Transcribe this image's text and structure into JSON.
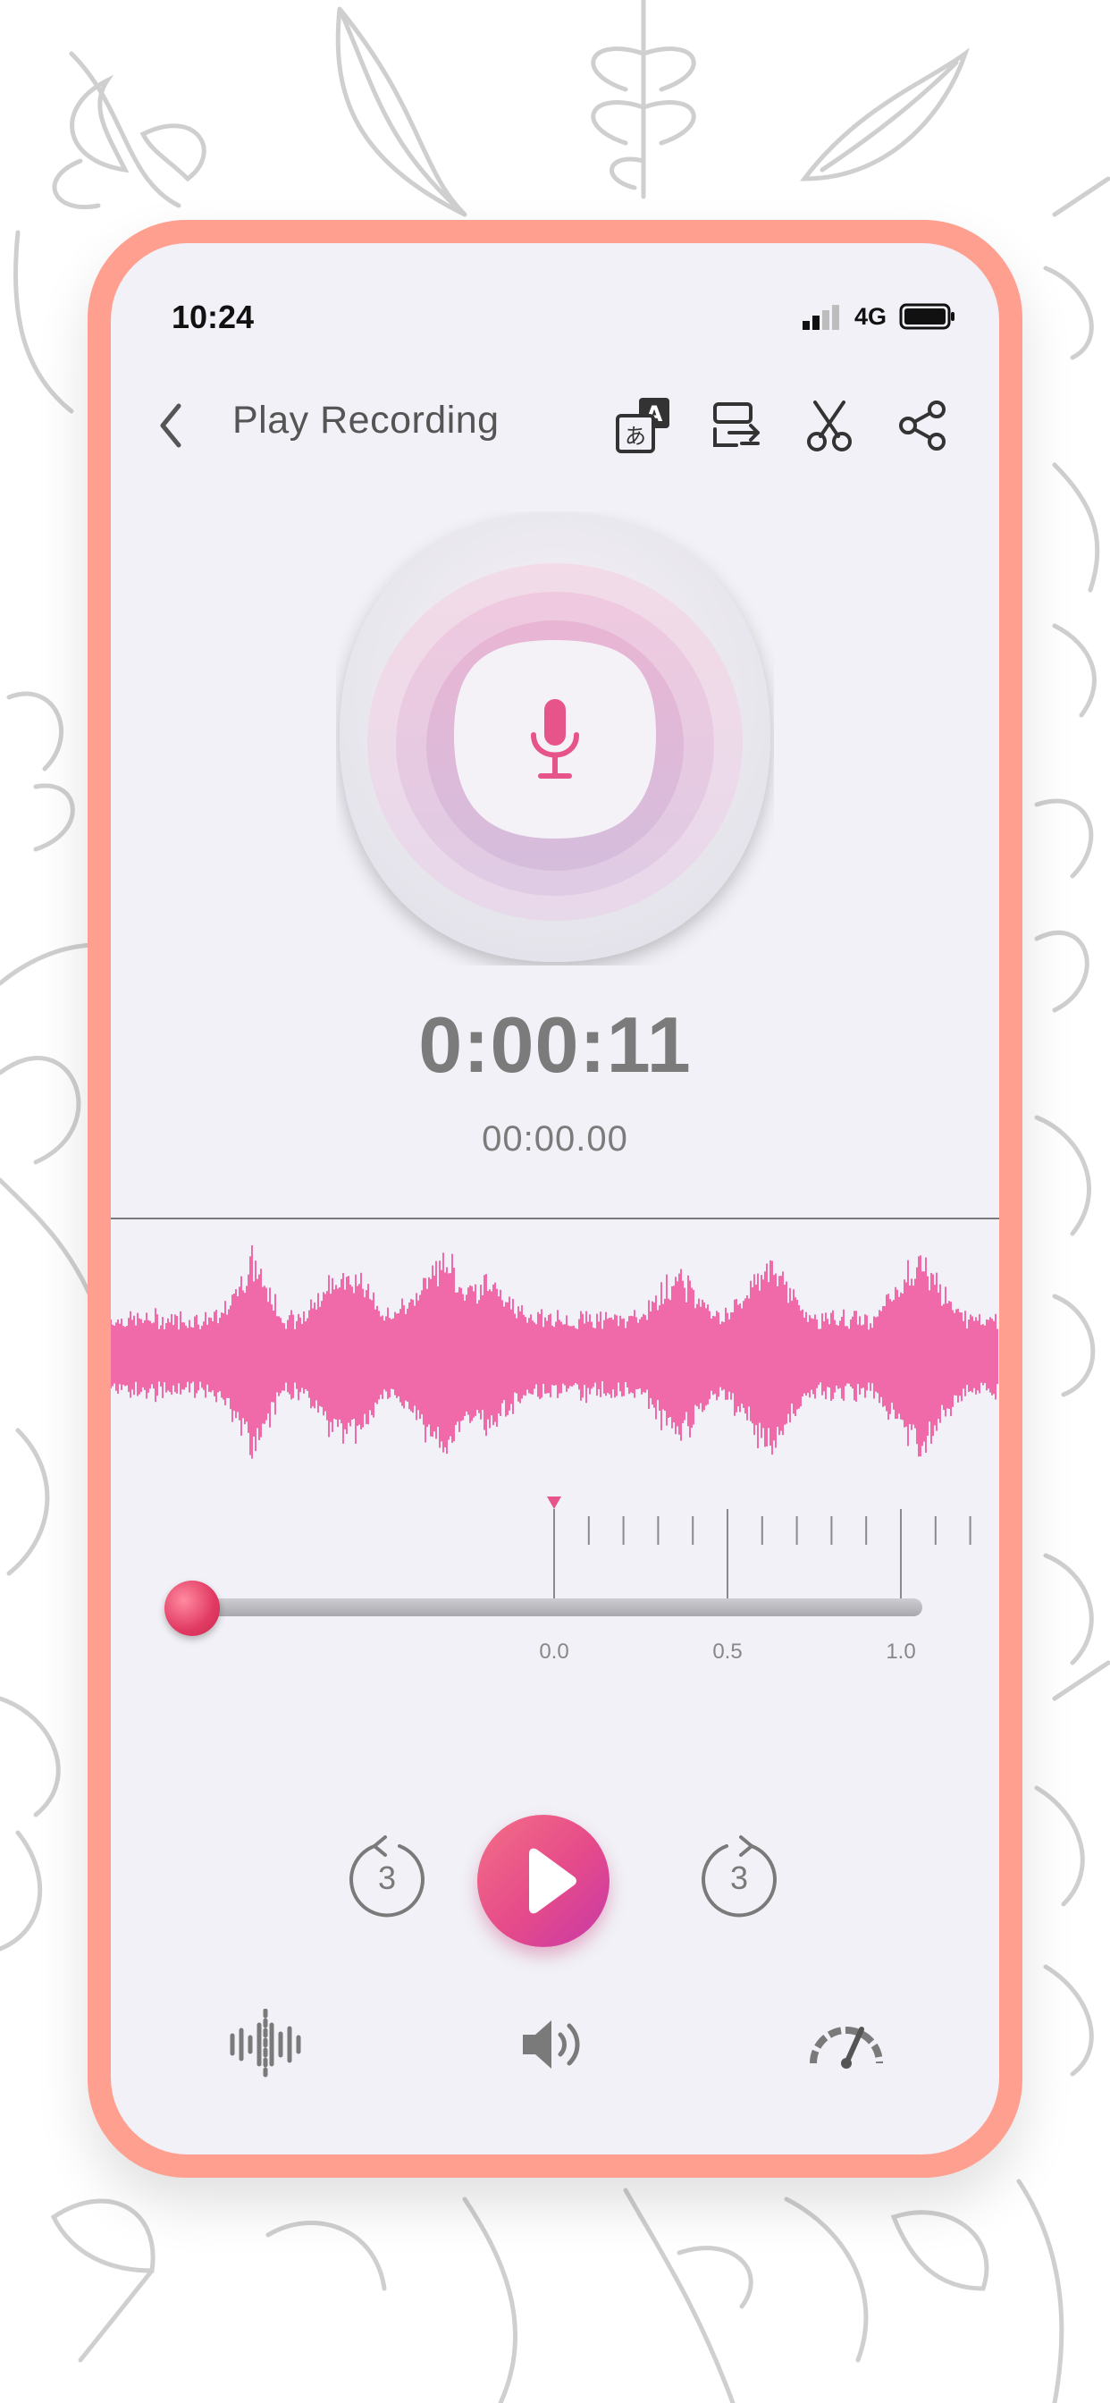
{
  "status_bar": {
    "time": "10:24",
    "network": "4G"
  },
  "header": {
    "back_icon": "chevron-left-icon",
    "title": "Play Recording",
    "actions": [
      "translate-icon",
      "convert-icon",
      "scissors-icon",
      "share-icon"
    ]
  },
  "recording": {
    "elapsed": "0:00:11",
    "position": "00:00.00",
    "mic_icon": "microphone-icon"
  },
  "timeline": {
    "labels": [
      "0.0",
      "0.5",
      "1.0"
    ]
  },
  "seek": {
    "progress": 0.0
  },
  "controls": {
    "rewind_seconds": "3",
    "forward_seconds": "3",
    "play_icon": "play-icon"
  },
  "bottom_bar": {
    "items": [
      "waveform-icon",
      "volume-icon",
      "speed-gauge-icon"
    ]
  },
  "colors": {
    "accent": "#ef5c94",
    "frame": "#ff9f8f",
    "screen": "#f1f1f7",
    "waveform": "#f06aaa"
  }
}
